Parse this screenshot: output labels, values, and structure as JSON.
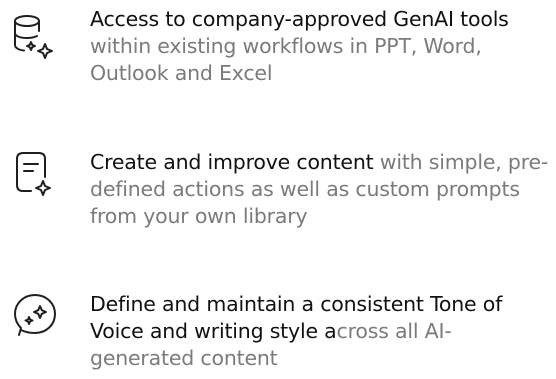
{
  "features": [
    {
      "icon": "database-sparkle-icon",
      "parts": [
        {
          "strong": "Access to company-approved GenAI tools",
          "light": ""
        },
        {
          "strong": "",
          "light": "within existing workflows in PPT, Word, Outlook and Excel"
        }
      ]
    },
    {
      "icon": "document-sparkle-icon",
      "parts": [
        {
          "strong": "Create and improve content",
          "light": " with simple, pre-defined actions as well as custom prompts from your own library"
        }
      ]
    },
    {
      "icon": "chat-sparkle-icon",
      "parts": [
        {
          "strong": "Define and maintain a consistent Tone of Voice and writing style a",
          "light": "cross all AI-generated content"
        }
      ]
    }
  ]
}
